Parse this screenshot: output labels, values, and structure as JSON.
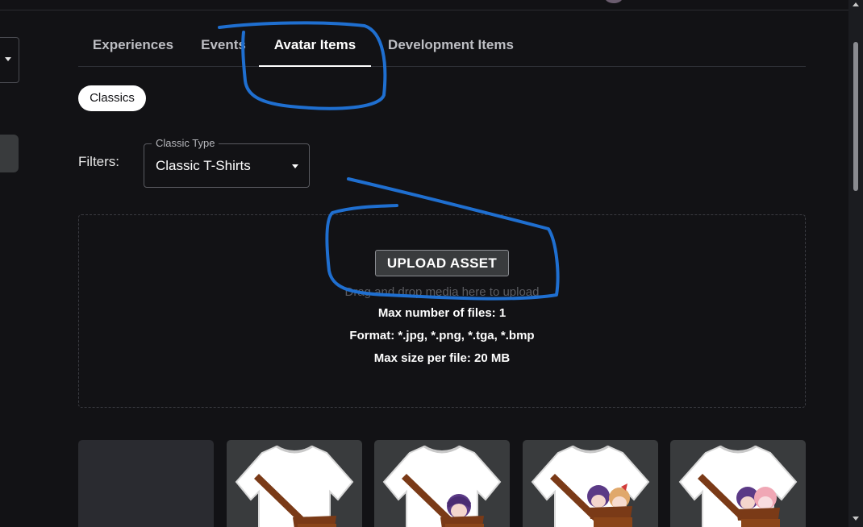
{
  "tabs": [
    {
      "label": "Experiences",
      "active": false
    },
    {
      "label": "Events",
      "active": false
    },
    {
      "label": "Avatar Items",
      "active": true
    },
    {
      "label": "Development Items",
      "active": false
    }
  ],
  "category_chip": {
    "label": "Classics"
  },
  "filters": {
    "label": "Filters:",
    "classic_type": {
      "legend": "Classic Type",
      "value": "Classic T-Shirts"
    }
  },
  "upload": {
    "button_label": "UPLOAD ASSET",
    "hint": "Drag and drop media here to upload",
    "max_files": "Max number of files: 1",
    "formats": "Format: *.jpg, *.png, *.tga, *.bmp",
    "max_size": "Max size per file: 20 MB"
  },
  "items": [
    {
      "kind": "placeholder"
    },
    {
      "kind": "tshirt",
      "characters": 0
    },
    {
      "kind": "tshirt",
      "characters": 1
    },
    {
      "kind": "tshirt",
      "characters": 2
    },
    {
      "kind": "tshirt",
      "characters": 2
    }
  ],
  "colors": {
    "background": "#121215",
    "annotation_ink": "#1f6fd0",
    "tile_background": "#393b3d",
    "strap_brown": "#7a3a17"
  },
  "icons": [
    "dropdown-caret-icon",
    "scroll-up-arrow-icon",
    "scroll-down-arrow-icon"
  ]
}
